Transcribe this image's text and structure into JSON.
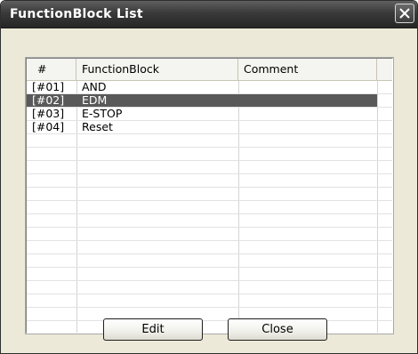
{
  "window": {
    "title": "FunctionBlock List"
  },
  "list": {
    "columns": [
      "#",
      "FunctionBlock",
      "Comment"
    ],
    "rows": [
      {
        "num": "[#01]",
        "name": "AND",
        "comment": ""
      },
      {
        "num": "[#02]",
        "name": "EDM",
        "comment": ""
      },
      {
        "num": "[#03]",
        "name": "E-STOP",
        "comment": ""
      },
      {
        "num": "[#04]",
        "name": "Reset",
        "comment": ""
      }
    ],
    "selected_index": 1
  },
  "buttons": {
    "edit_label": "Edit",
    "close_label": "Close"
  },
  "colors": {
    "titlebar": "#3a3a3a",
    "selection": "#595959",
    "dialog_bg": "#ece9d8"
  }
}
